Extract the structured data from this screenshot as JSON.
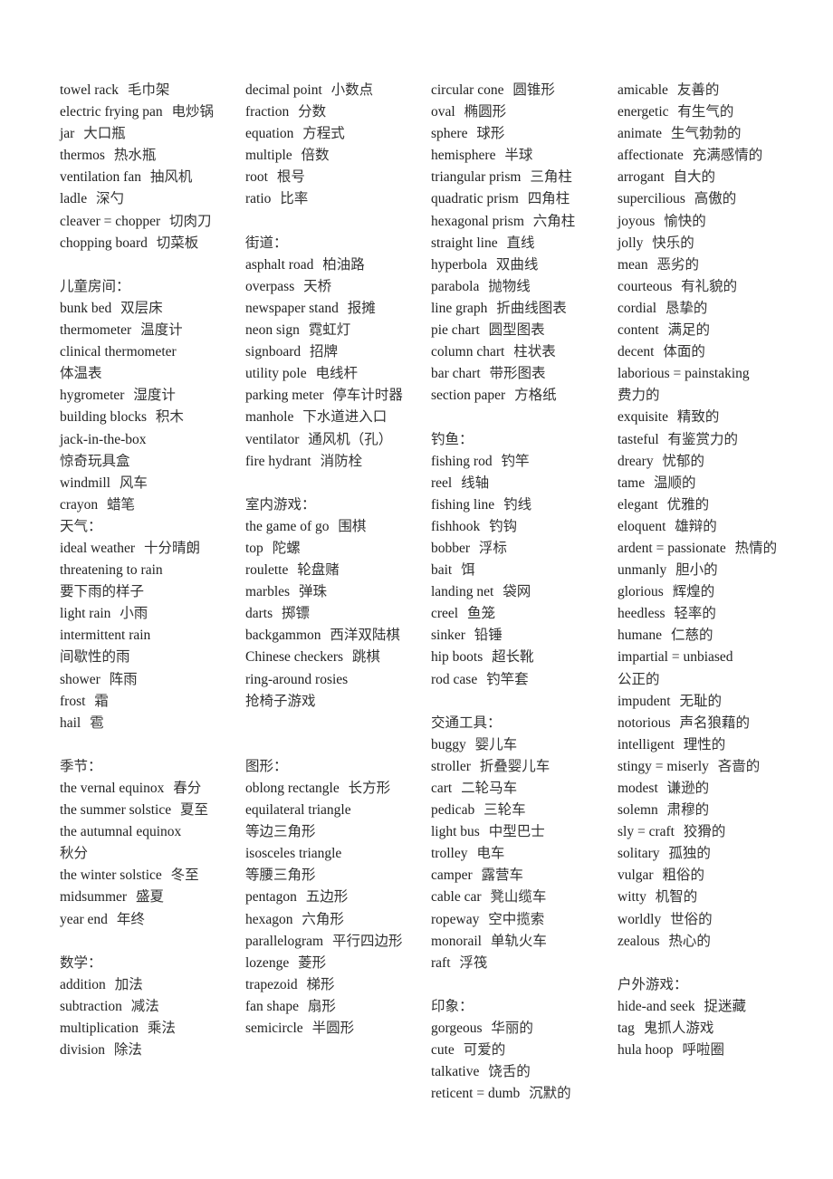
{
  "columns": [
    {
      "lines": [
        {
          "type": "entry",
          "en": "towel rack",
          "zh": "毛巾架"
        },
        {
          "type": "entry",
          "en": "electric frying pan",
          "zh": "电炒锅"
        },
        {
          "type": "entry",
          "en": "jar",
          "zh": "大口瓶"
        },
        {
          "type": "entry",
          "en": "thermos",
          "zh": "热水瓶"
        },
        {
          "type": "entry",
          "en": "ventilation fan",
          "zh": "抽风机"
        },
        {
          "type": "entry",
          "en": "ladle",
          "zh": "深勺"
        },
        {
          "type": "entry",
          "en": "cleaver = chopper",
          "zh": "切肉刀"
        },
        {
          "type": "entry",
          "en": "chopping board",
          "zh": "切菜板"
        },
        {
          "type": "blank"
        },
        {
          "type": "heading",
          "text": "儿童房间："
        },
        {
          "type": "entry",
          "en": "bunk bed",
          "zh": "双层床"
        },
        {
          "type": "entry",
          "en": "thermometer",
          "zh": "温度计"
        },
        {
          "type": "entry",
          "en": "clinical thermometer",
          "zh": "体温表",
          "wrap": true
        },
        {
          "type": "entry",
          "en": "hygrometer",
          "zh": "湿度计"
        },
        {
          "type": "entry",
          "en": "building blocks",
          "zh": "积木"
        },
        {
          "type": "entry",
          "en": "jack-in-the-box",
          "zh": "惊奇玩具盒",
          "wrap": true
        },
        {
          "type": "entry",
          "en": "windmill",
          "zh": "风车"
        },
        {
          "type": "entry",
          "en": "crayon",
          "zh": "蜡笔"
        },
        {
          "type": "heading",
          "text": "天气："
        },
        {
          "type": "entry",
          "en": "ideal weather",
          "zh": "十分晴朗"
        },
        {
          "type": "entry",
          "en": "threatening to rain",
          "zh": "要下雨的样子",
          "wrap": true
        },
        {
          "type": "entry",
          "en": "light rain",
          "zh": "小雨"
        },
        {
          "type": "entry",
          "en": "intermittent rain",
          "zh": "间歇性的雨",
          "wrap": true
        },
        {
          "type": "entry",
          "en": "shower",
          "zh": "阵雨"
        },
        {
          "type": "entry",
          "en": "frost",
          "zh": "霜"
        },
        {
          "type": "entry",
          "en": "hail",
          "zh": "雹"
        },
        {
          "type": "blank"
        },
        {
          "type": "heading",
          "text": "季节："
        },
        {
          "type": "entry",
          "en": "the vernal equinox",
          "zh": "春分"
        },
        {
          "type": "entry",
          "en": "the summer solstice",
          "zh": "夏至",
          "justify": true
        },
        {
          "type": "entry",
          "en": "the autumnal equinox",
          "zh": "秋分",
          "wrap": true,
          "justify": true
        },
        {
          "type": "entry",
          "en": "the winter solstice",
          "zh": "冬至"
        },
        {
          "type": "entry",
          "en": "midsummer",
          "zh": "盛夏"
        },
        {
          "type": "entry",
          "en": "year end",
          "zh": "年终"
        },
        {
          "type": "blank"
        },
        {
          "type": "heading",
          "text": "数学："
        },
        {
          "type": "entry",
          "en": "addition",
          "zh": "加法"
        },
        {
          "type": "entry",
          "en": "subtraction",
          "zh": "减法"
        },
        {
          "type": "entry",
          "en": "multiplication",
          "zh": "乘法"
        },
        {
          "type": "entry",
          "en": "division",
          "zh": "除法"
        }
      ]
    },
    {
      "lines": [
        {
          "type": "entry",
          "en": "decimal point",
          "zh": "小数点"
        },
        {
          "type": "entry",
          "en": "fraction",
          "zh": "分数"
        },
        {
          "type": "entry",
          "en": "equation",
          "zh": "方程式"
        },
        {
          "type": "entry",
          "en": "multiple",
          "zh": "倍数"
        },
        {
          "type": "entry",
          "en": "root",
          "zh": "根号"
        },
        {
          "type": "entry",
          "en": "ratio",
          "zh": "比率"
        },
        {
          "type": "blank"
        },
        {
          "type": "heading",
          "text": "街道："
        },
        {
          "type": "entry",
          "en": "asphalt road",
          "zh": "柏油路"
        },
        {
          "type": "entry",
          "en": "overpass",
          "zh": "天桥"
        },
        {
          "type": "entry",
          "en": "newspaper stand",
          "zh": "报摊"
        },
        {
          "type": "entry",
          "en": "neon sign",
          "zh": "霓虹灯"
        },
        {
          "type": "entry",
          "en": "signboard",
          "zh": "招牌"
        },
        {
          "type": "entry",
          "en": "utility pole",
          "zh": "电线杆"
        },
        {
          "type": "entry",
          "en": "parking meter",
          "zh": "停车计时器",
          "justify": true
        },
        {
          "type": "entry",
          "en": "manhole",
          "zh": "下水道进入口"
        },
        {
          "type": "entry",
          "en": "ventilator",
          "zh": "通风机（孔）"
        },
        {
          "type": "entry",
          "en": "fire hydrant",
          "zh": "消防栓"
        },
        {
          "type": "blank"
        },
        {
          "type": "heading",
          "text": "室内游戏："
        },
        {
          "type": "entry",
          "en": "the game of go",
          "zh": "围棋"
        },
        {
          "type": "entry",
          "en": "top",
          "zh": "陀螺"
        },
        {
          "type": "entry",
          "en": "roulette",
          "zh": "轮盘赌"
        },
        {
          "type": "entry",
          "en": "marbles",
          "zh": "弹珠"
        },
        {
          "type": "entry",
          "en": "darts",
          "zh": "掷镖"
        },
        {
          "type": "entry",
          "en": "backgammon",
          "zh": "西洋双陆棋"
        },
        {
          "type": "entry",
          "en": "Chinese checkers",
          "zh": "跳棋"
        },
        {
          "type": "entry",
          "en": "ring-around rosies",
          "zh": "抢椅子游戏",
          "wrap": true
        },
        {
          "type": "blank"
        },
        {
          "type": "blank"
        },
        {
          "type": "heading",
          "text": "图形："
        },
        {
          "type": "entry",
          "en": "oblong rectangle",
          "zh": "长方形",
          "justify": true
        },
        {
          "type": "entry",
          "en": "equilateral triangle",
          "zh": "等边三角形",
          "wrap": true
        },
        {
          "type": "entry",
          "en": "isosceles triangle",
          "zh": "等腰三角形",
          "wrap": true
        },
        {
          "type": "entry",
          "en": "pentagon",
          "zh": "五边形"
        },
        {
          "type": "entry",
          "en": "hexagon",
          "zh": "六角形"
        },
        {
          "type": "entry",
          "en": "parallelogram",
          "zh": "平行四边形",
          "justify": true
        },
        {
          "type": "entry",
          "en": "lozenge",
          "zh": "菱形"
        },
        {
          "type": "entry",
          "en": "trapezoid",
          "zh": "梯形"
        },
        {
          "type": "entry",
          "en": "fan shape",
          "zh": "扇形"
        },
        {
          "type": "entry",
          "en": "semicircle",
          "zh": "半圆形"
        }
      ]
    },
    {
      "lines": [
        {
          "type": "entry",
          "en": "circular cone",
          "zh": "圆锥形"
        },
        {
          "type": "entry",
          "en": "oval",
          "zh": "椭圆形"
        },
        {
          "type": "entry",
          "en": "sphere",
          "zh": "球形"
        },
        {
          "type": "entry",
          "en": "hemisphere",
          "zh": "半球"
        },
        {
          "type": "entry",
          "en": "triangular prism",
          "zh": "三角柱"
        },
        {
          "type": "entry",
          "en": "quadratic prism",
          "zh": "四角柱"
        },
        {
          "type": "entry",
          "en": "hexagonal prism",
          "zh": "六角柱",
          "justify": true
        },
        {
          "type": "entry",
          "en": "straight line",
          "zh": "直线"
        },
        {
          "type": "entry",
          "en": "hyperbola",
          "zh": "双曲线"
        },
        {
          "type": "entry",
          "en": "parabola",
          "zh": "抛物线"
        },
        {
          "type": "entry",
          "en": "line graph",
          "zh": "折曲线图表"
        },
        {
          "type": "entry",
          "en": "pie chart",
          "zh": "圆型图表"
        },
        {
          "type": "entry",
          "en": "column chart",
          "zh": "柱状表"
        },
        {
          "type": "entry",
          "en": "bar chart",
          "zh": "带形图表"
        },
        {
          "type": "entry",
          "en": "section paper",
          "zh": "方格纸"
        },
        {
          "type": "blank"
        },
        {
          "type": "heading",
          "text": "钓鱼："
        },
        {
          "type": "entry",
          "en": "fishing rod",
          "zh": "钓竿"
        },
        {
          "type": "entry",
          "en": "reel",
          "zh": "线轴"
        },
        {
          "type": "entry",
          "en": "fishing line",
          "zh": "钓线"
        },
        {
          "type": "entry",
          "en": "fishhook",
          "zh": "钓钩"
        },
        {
          "type": "entry",
          "en": "bobber",
          "zh": "浮标"
        },
        {
          "type": "entry",
          "en": "bait",
          "zh": "饵"
        },
        {
          "type": "entry",
          "en": "landing net",
          "zh": "袋网"
        },
        {
          "type": "entry",
          "en": "creel",
          "zh": "鱼笼"
        },
        {
          "type": "entry",
          "en": "sinker",
          "zh": "铅锤"
        },
        {
          "type": "entry",
          "en": "hip boots",
          "zh": "超长靴"
        },
        {
          "type": "entry",
          "en": "rod case",
          "zh": "钓竿套"
        },
        {
          "type": "blank"
        },
        {
          "type": "heading",
          "text": "交通工具："
        },
        {
          "type": "entry",
          "en": "buggy",
          "zh": "婴儿车"
        },
        {
          "type": "entry",
          "en": "stroller",
          "zh": "折叠婴儿车"
        },
        {
          "type": "entry",
          "en": "cart",
          "zh": "二轮马车"
        },
        {
          "type": "entry",
          "en": "pedicab",
          "zh": "三轮车"
        },
        {
          "type": "entry",
          "en": "light bus",
          "zh": "中型巴士"
        },
        {
          "type": "entry",
          "en": "trolley",
          "zh": "电车"
        },
        {
          "type": "entry",
          "en": "camper",
          "zh": "露营车"
        },
        {
          "type": "entry",
          "en": "cable car",
          "zh": "凳山缆车"
        },
        {
          "type": "entry",
          "en": "ropeway",
          "zh": "空中揽索"
        },
        {
          "type": "entry",
          "en": "monorail",
          "zh": "单轨火车"
        },
        {
          "type": "entry",
          "en": "raft",
          "zh": "浮筏"
        },
        {
          "type": "blank"
        },
        {
          "type": "heading",
          "text": "印象："
        },
        {
          "type": "entry",
          "en": "gorgeous",
          "zh": "华丽的"
        },
        {
          "type": "entry",
          "en": "cute",
          "zh": "可爱的"
        },
        {
          "type": "entry",
          "en": "talkative",
          "zh": "饶舌的"
        },
        {
          "type": "entry",
          "en": "reticent = dumb",
          "zh": "沉默的"
        }
      ]
    },
    {
      "lines": [
        {
          "type": "entry",
          "en": "amicable",
          "zh": "友善的"
        },
        {
          "type": "entry",
          "en": "energetic",
          "zh": "有生气的"
        },
        {
          "type": "entry",
          "en": "animate",
          "zh": "生气勃勃的"
        },
        {
          "type": "entry",
          "en": "affectionate",
          "zh": "充满感情的",
          "justify": true
        },
        {
          "type": "entry",
          "en": "arrogant",
          "zh": "自大的"
        },
        {
          "type": "entry",
          "en": "supercilious",
          "zh": "高傲的"
        },
        {
          "type": "entry",
          "en": "joyous",
          "zh": "愉快的"
        },
        {
          "type": "entry",
          "en": "jolly",
          "zh": "快乐的"
        },
        {
          "type": "entry",
          "en": "mean",
          "zh": "恶劣的"
        },
        {
          "type": "entry",
          "en": "courteous",
          "zh": "有礼貌的"
        },
        {
          "type": "entry",
          "en": "cordial",
          "zh": "恳挚的"
        },
        {
          "type": "entry",
          "en": "content",
          "zh": "满足的"
        },
        {
          "type": "entry",
          "en": "decent",
          "zh": "体面的"
        },
        {
          "type": "entry",
          "en": "laborious = painstaking",
          "zh": "费力的",
          "wrap": true
        },
        {
          "type": "entry",
          "en": "exquisite",
          "zh": "精致的"
        },
        {
          "type": "entry",
          "en": "tasteful",
          "zh": "有鉴赏力的"
        },
        {
          "type": "entry",
          "en": "dreary",
          "zh": "忧郁的"
        },
        {
          "type": "entry",
          "en": "tame",
          "zh": "温顺的"
        },
        {
          "type": "entry",
          "en": "elegant",
          "zh": "优雅的"
        },
        {
          "type": "entry",
          "en": "eloquent",
          "zh": "雄辩的"
        },
        {
          "type": "entry",
          "en": "ardent = passionate",
          "zh": "热情的",
          "justify": true
        },
        {
          "type": "entry",
          "en": "unmanly",
          "zh": "胆小的"
        },
        {
          "type": "entry",
          "en": "glorious",
          "zh": "辉煌的"
        },
        {
          "type": "entry",
          "en": "heedless",
          "zh": "轻率的"
        },
        {
          "type": "entry",
          "en": "humane",
          "zh": "仁慈的"
        },
        {
          "type": "entry",
          "en": "impartial = unbiased",
          "zh": "公正的",
          "wrap": true
        },
        {
          "type": "entry",
          "en": "impudent",
          "zh": "无耻的"
        },
        {
          "type": "entry",
          "en": "notorious",
          "zh": "声名狼藉的"
        },
        {
          "type": "entry",
          "en": "intelligent",
          "zh": "理性的"
        },
        {
          "type": "entry",
          "en": "stingy = miserly",
          "zh": "吝啬的",
          "justify": true
        },
        {
          "type": "entry",
          "en": "modest",
          "zh": "谦逊的"
        },
        {
          "type": "entry",
          "en": "solemn",
          "zh": "肃穆的"
        },
        {
          "type": "entry",
          "en": "sly = craft",
          "zh": "狡猾的"
        },
        {
          "type": "entry",
          "en": "solitary",
          "zh": "孤独的"
        },
        {
          "type": "entry",
          "en": "vulgar",
          "zh": "粗俗的"
        },
        {
          "type": "entry",
          "en": "witty",
          "zh": "机智的"
        },
        {
          "type": "entry",
          "en": "worldly",
          "zh": "世俗的"
        },
        {
          "type": "entry",
          "en": "zealous",
          "zh": "热心的"
        },
        {
          "type": "blank"
        },
        {
          "type": "heading",
          "text": "户外游戏："
        },
        {
          "type": "entry",
          "en": "hide-and seek",
          "zh": "捉迷藏"
        },
        {
          "type": "entry",
          "en": "tag",
          "zh": "鬼抓人游戏"
        },
        {
          "type": "entry",
          "en": "hula hoop",
          "zh": "呼啦圈"
        }
      ]
    }
  ]
}
